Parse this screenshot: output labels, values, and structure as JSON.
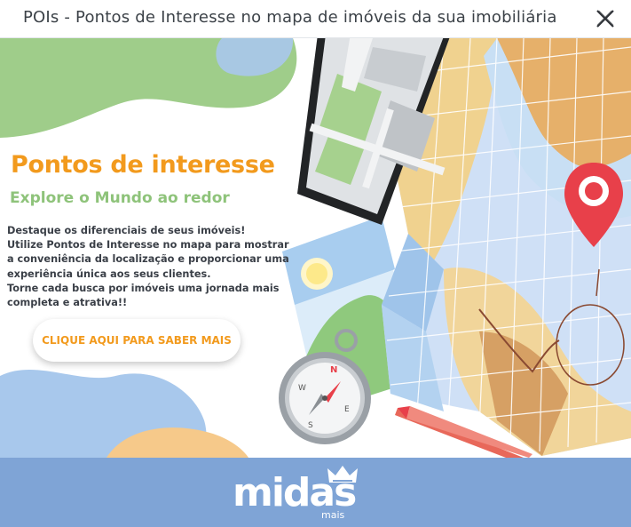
{
  "modal": {
    "title": "POIs - Pontos de Interesse no mapa de imóveis da sua imobiliária",
    "close_icon": "close-icon"
  },
  "banner": {
    "headline": "Pontos de interesse",
    "subheadline": "Explore o Mundo ao redor",
    "body_lines": [
      "Destaque os diferenciais de seus imóveis!",
      "Utilize Pontos de Interesse no mapa para mostrar",
      "a conveniência da localização e proporcionar uma",
      "experiência única aos seus clientes.",
      "Torne cada busca por imóveis uma jornada mais",
      "completa e atrativa!!"
    ],
    "cta_label": "CLIQUE AQUI PARA SABER MAIS",
    "illustration_icons": [
      "smartphone-map-icon",
      "folded-map-icon",
      "map-pin-icon",
      "compass-icon",
      "pencil-icon",
      "sun-icon"
    ],
    "colors": {
      "orange": "#f29a1d",
      "green": "#8ec37a",
      "blue": "#7fa4d6",
      "pin_red": "#e8404a"
    }
  },
  "footer": {
    "logo_text": "midas",
    "logo_subtext": "mais",
    "background": "#7fa4d6"
  }
}
